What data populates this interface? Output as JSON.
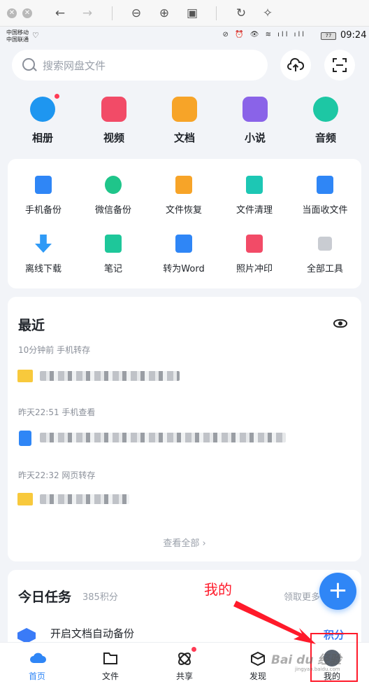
{
  "status": {
    "carrier_1": "中国移动",
    "carrier_2": "中国联通",
    "battery": "77",
    "time": "09:24"
  },
  "search": {
    "placeholder": "搜索网盘文件"
  },
  "categories": [
    {
      "label": "相册",
      "icon": "photo-album-icon",
      "color": "#1e96f0"
    },
    {
      "label": "视频",
      "icon": "video-icon",
      "color": "#f24b67"
    },
    {
      "label": "文档",
      "icon": "document-icon",
      "color": "#f7a428"
    },
    {
      "label": "小说",
      "icon": "novel-book-icon",
      "color": "#8a63e8"
    },
    {
      "label": "音频",
      "icon": "headphones-icon",
      "color": "#1dc7a4"
    }
  ],
  "tools": [
    {
      "label": "手机备份",
      "icon": "phone-backup-icon",
      "color": "#2f86f6"
    },
    {
      "label": "微信备份",
      "icon": "wechat-backup-icon",
      "color": "#1fc58a"
    },
    {
      "label": "文件恢复",
      "icon": "file-restore-icon",
      "color": "#f7a428"
    },
    {
      "label": "文件清理",
      "icon": "file-clean-icon",
      "color": "#1dc7b4"
    },
    {
      "label": "当面收文件",
      "icon": "receive-file-icon",
      "color": "#2f86f6"
    },
    {
      "label": "离线下载",
      "icon": "offline-download-icon",
      "color": "#2f9af6"
    },
    {
      "label": "笔记",
      "icon": "notes-icon",
      "color": "#1ec79a"
    },
    {
      "label": "转为Word",
      "icon": "convert-word-icon",
      "color": "#2f86f6"
    },
    {
      "label": "照片冲印",
      "icon": "photo-print-icon",
      "color": "#f24b67"
    },
    {
      "label": "全部工具",
      "icon": "all-tools-icon",
      "color": "#c9ccd2"
    }
  ],
  "recent": {
    "title": "最近",
    "items": [
      {
        "meta": "10分钟前   手机转存",
        "icon": "folder-icon"
      },
      {
        "meta": "昨天22:51   手机查看",
        "icon": "text-file-icon"
      },
      {
        "meta": "昨天22:32   网页转存",
        "icon": "folder-icon"
      }
    ],
    "view_all": "查看全部 ›"
  },
  "tasks": {
    "title": "今日任务",
    "points": "385积分",
    "more": "领取更多",
    "item": "开启文档自动备份",
    "reward": "积分"
  },
  "nav": [
    {
      "label": "首页",
      "icon": "home-cloud-icon",
      "active": true
    },
    {
      "label": "文件",
      "icon": "folder-outline-icon"
    },
    {
      "label": "共享",
      "icon": "share-orbit-icon"
    },
    {
      "label": "发现",
      "icon": "discover-cube-icon"
    },
    {
      "label": "我的",
      "icon": "avatar-icon"
    }
  ],
  "annotation": {
    "text": "我的",
    "color": "#ff1a2a"
  },
  "watermark": {
    "text": "Bai du 经验",
    "sub": "jingyan.baidu.com"
  }
}
